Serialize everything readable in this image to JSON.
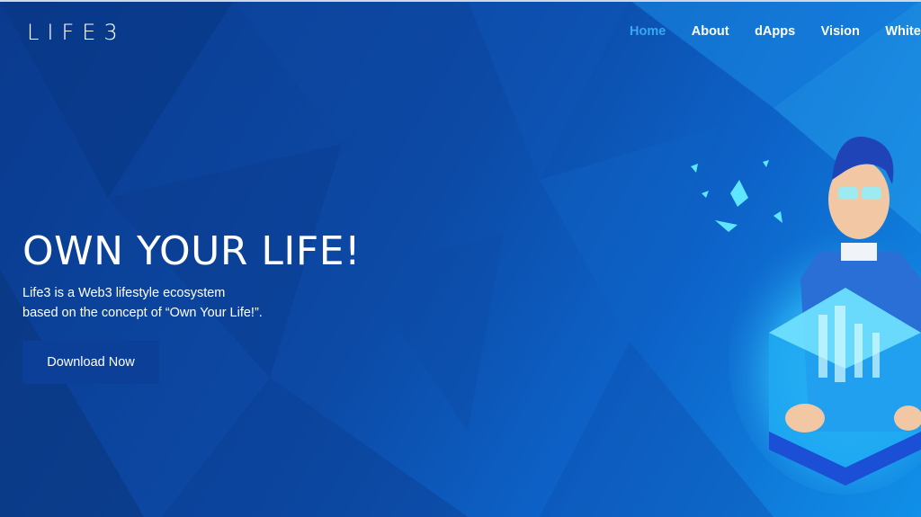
{
  "header": {
    "logo": "LIFE3",
    "nav": [
      {
        "label": "Home",
        "active": true
      },
      {
        "label": "About",
        "active": false
      },
      {
        "label": "dApps",
        "active": false
      },
      {
        "label": "Vision",
        "active": false
      },
      {
        "label": "Whitepaper",
        "active": false
      }
    ]
  },
  "hero": {
    "title": "OWN YOUR LIFE!",
    "description_line1": "Life3 is a Web3 lifestyle ecosystem",
    "description_line2": "based on the concept of “Own Your Life!”.",
    "cta_label": "Download Now"
  },
  "colors": {
    "nav_active": "#39a8f2",
    "button_bg": "#0c3f97",
    "background": "#0c4aa6",
    "accent_glow": "#46e3ff"
  },
  "illustration": {
    "icon": "person-with-glowing-cube-illustration"
  }
}
